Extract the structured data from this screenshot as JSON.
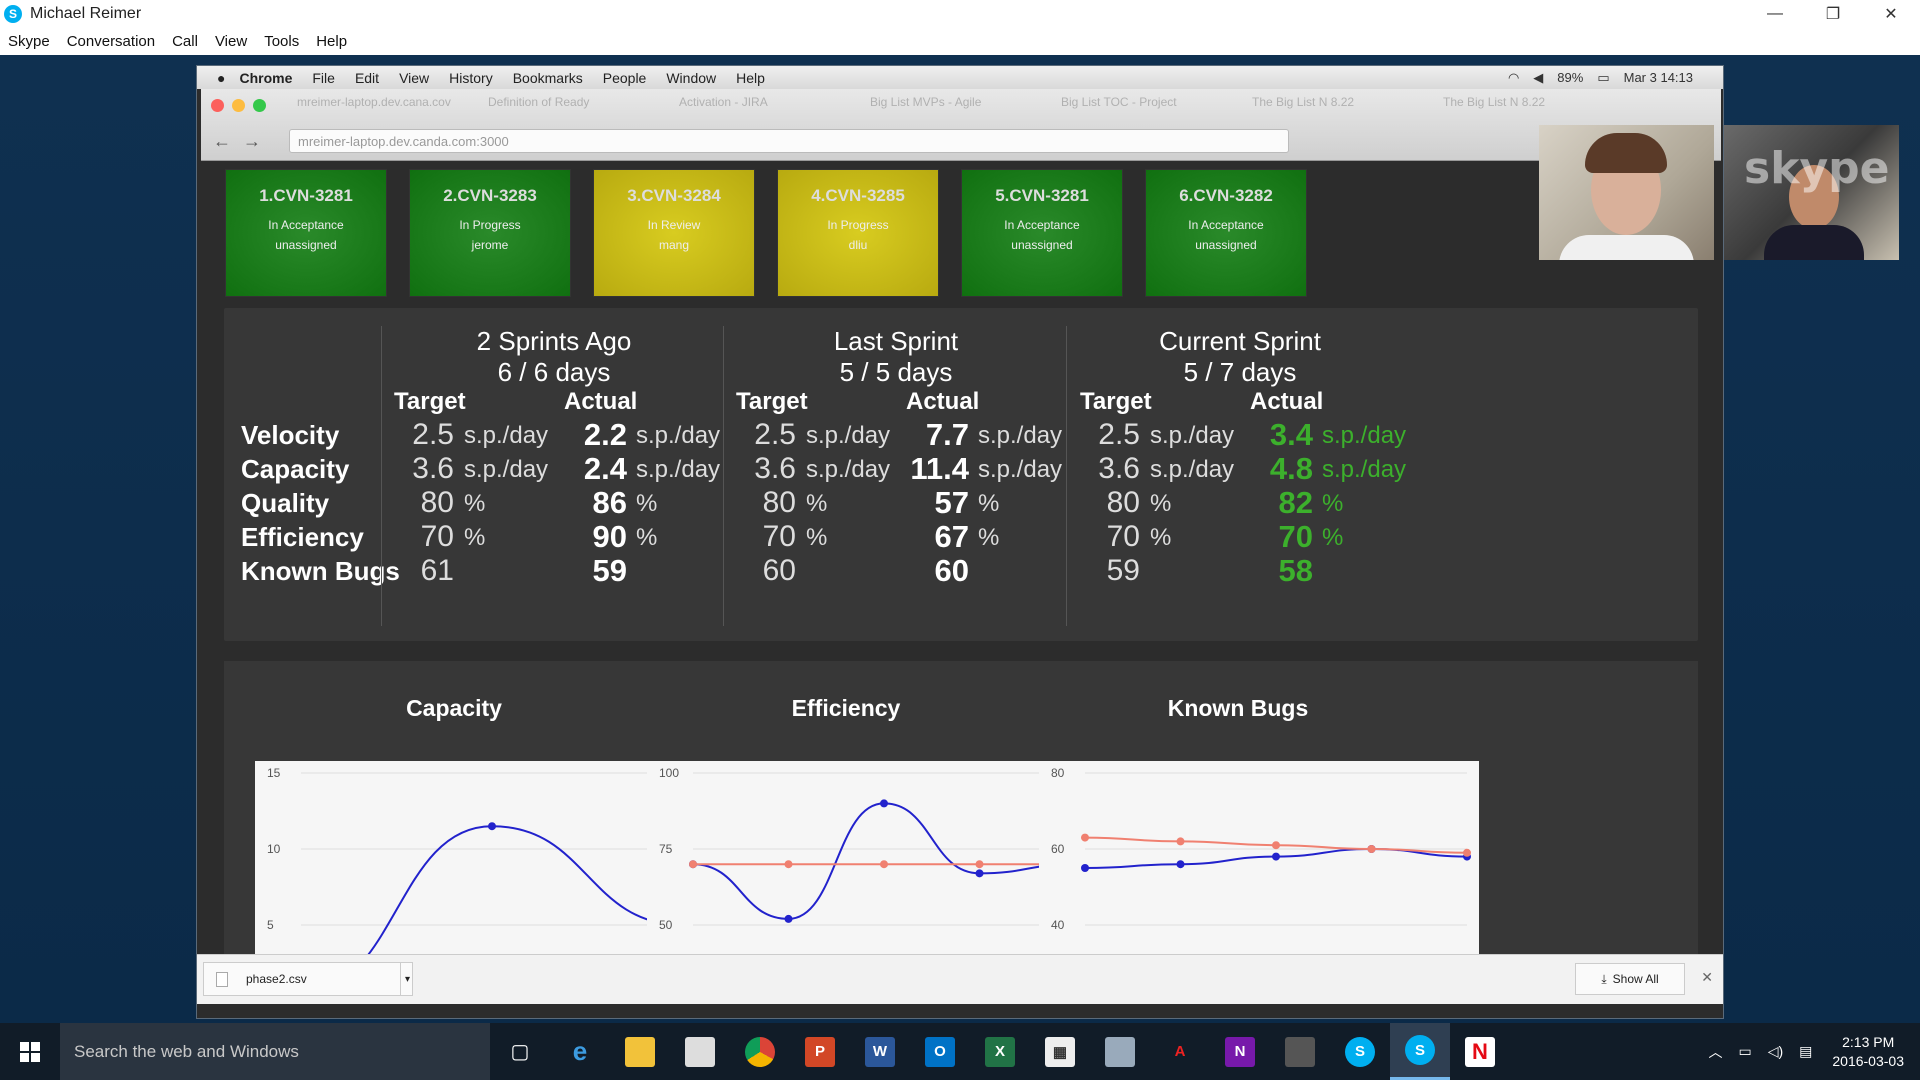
{
  "skype": {
    "title": "Michael Reimer",
    "menu": [
      "Skype",
      "Conversation",
      "Call",
      "View",
      "Tools",
      "Help"
    ],
    "window_controls": {
      "minimize": "—",
      "restore": "❐",
      "close": "✕"
    }
  },
  "mac_menubar": {
    "app": "Chrome",
    "items": [
      "File",
      "Edit",
      "View",
      "History",
      "Bookmarks",
      "People",
      "Window",
      "Help"
    ],
    "battery": "89%",
    "clock": "Mar 3 14:13"
  },
  "chrome": {
    "tabs": [
      "mreimer-laptop.dev.cana.cov",
      "Definition of Ready",
      "Activation - JIRA",
      "Big List MVPs - Agile",
      "Big List TOC - Project",
      "The Big List N 8.22",
      "The Big List N 8.22"
    ],
    "url": "mreimer-laptop.dev.canda.com:3000"
  },
  "cards": [
    {
      "id": "1.CVN-3281",
      "status": "In Acceptance",
      "assignee": "unassigned",
      "color": "green"
    },
    {
      "id": "2.CVN-3283",
      "status": "In Progress",
      "assignee": "jerome",
      "color": "green"
    },
    {
      "id": "3.CVN-3284",
      "status": "In Review",
      "assignee": "mang",
      "color": "yellow"
    },
    {
      "id": "4.CVN-3285",
      "status": "In Progress",
      "assignee": "dliu",
      "color": "yellow"
    },
    {
      "id": "5.CVN-3281",
      "status": "In Acceptance",
      "assignee": "unassigned",
      "color": "green"
    },
    {
      "id": "6.CVN-3282",
      "status": "In Acceptance",
      "assignee": "unassigned",
      "color": "green"
    }
  ],
  "metrics": {
    "rows": [
      "Velocity",
      "Capacity",
      "Quality",
      "Efficiency",
      "Known Bugs"
    ],
    "target_label": "Target",
    "actual_label": "Actual",
    "sprints": [
      {
        "title": "2 Sprints Ago",
        "days": "6 / 6 days",
        "target": [
          "2.5",
          "3.6",
          "80",
          "70",
          "61"
        ],
        "target_units": [
          "s.p./day",
          "s.p./day",
          "%",
          "%",
          ""
        ],
        "actual": [
          "2.2",
          "2.4",
          "86",
          "90",
          "59"
        ],
        "actual_units": [
          "s.p./day",
          "s.p./day",
          "%",
          "%",
          ""
        ]
      },
      {
        "title": "Last Sprint",
        "days": "5 / 5 days",
        "target": [
          "2.5",
          "3.6",
          "80",
          "70",
          "60"
        ],
        "target_units": [
          "s.p./day",
          "s.p./day",
          "%",
          "%",
          ""
        ],
        "actual": [
          "7.7",
          "11.4",
          "57",
          "67",
          "60"
        ],
        "actual_units": [
          "s.p./day",
          "s.p./day",
          "%",
          "%",
          ""
        ]
      },
      {
        "title": "Current Sprint",
        "days": "5 / 7 days",
        "target": [
          "2.5",
          "3.6",
          "80",
          "70",
          "59"
        ],
        "target_units": [
          "s.p./day",
          "s.p./day",
          "%",
          "%",
          ""
        ],
        "actual": [
          "3.4",
          "4.8",
          "82",
          "70",
          "58"
        ],
        "actual_units": [
          "s.p./day",
          "s.p./day",
          "%",
          "%",
          ""
        ],
        "actual_color": "#3cb02c"
      }
    ]
  },
  "chart_data": [
    {
      "type": "line",
      "title": "Capacity",
      "ylim": [
        5,
        15
      ],
      "yticks": [
        15,
        10,
        5
      ],
      "series": [
        {
          "values": [
            0.5,
            11.5,
            5
          ],
          "color": "#2222cc"
        }
      ]
    },
    {
      "type": "line",
      "title": "Efficiency",
      "ylim": [
        50,
        100
      ],
      "yticks": [
        100,
        75,
        50
      ],
      "series": [
        {
          "values": [
            70,
            52,
            90,
            67,
            70
          ],
          "color": "#2222cc"
        },
        {
          "values": [
            70,
            70,
            70,
            70,
            70
          ],
          "color": "#f08070"
        }
      ]
    },
    {
      "type": "line",
      "title": "Known Bugs",
      "ylim": [
        40,
        80
      ],
      "yticks": [
        80,
        60,
        40
      ],
      "series": [
        {
          "values": [
            55,
            56,
            58,
            60,
            58
          ],
          "color": "#2222cc"
        },
        {
          "values": [
            63,
            62,
            61,
            60,
            59
          ],
          "color": "#f08070"
        }
      ]
    }
  ],
  "download": {
    "file": "phase2.csv",
    "show_all": "Show All"
  },
  "taskbar": {
    "search_placeholder": "Search the web and Windows",
    "time": "2:13 PM",
    "date": "2016-03-03"
  }
}
